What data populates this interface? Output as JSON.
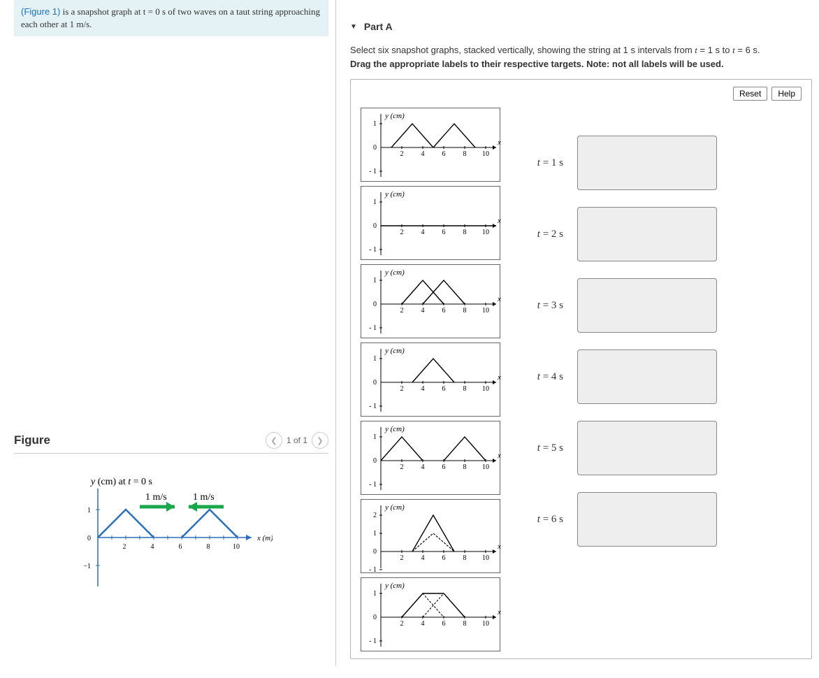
{
  "info": {
    "link": "(Figure 1)",
    "rest": " is a snapshot graph at t = 0 s of two waves on a taut string approaching each other at 1 m/s."
  },
  "figure": {
    "heading": "Figure",
    "counter": "1 of 1",
    "title": "y (cm) at t = 0 s",
    "ylabel": "y (cm)",
    "xlabel": "x (m)",
    "speed1": "1 m/s",
    "speed2": "1 m/s",
    "yticks": [
      "1",
      "0",
      "−1"
    ],
    "xticks": [
      "2",
      "4",
      "6",
      "8",
      "10"
    ]
  },
  "partA": {
    "title": "Part A",
    "instr": "Select six snapshot graphs, stacked vertically, showing the string at 1 s intervals from t = 1 s to t = 6 s.",
    "subinstr": "Drag the appropriate labels to their respective targets. Note: not all labels will be used.",
    "reset": "Reset",
    "help": "Help",
    "targets": [
      "t = 1 s",
      "t = 2 s",
      "t = 3 s",
      "t = 4 s",
      "t = 5 s",
      "t = 6 s"
    ],
    "label_ylabel": "y (cm)",
    "label_xlabel": "x (m)",
    "label_xticks": [
      "2",
      "4",
      "6",
      "8",
      "10"
    ]
  },
  "chart_data": {
    "figure1": {
      "type": "line",
      "title": "y (cm) at t = 0 s",
      "xlabel": "x (m)",
      "ylabel": "y (cm)",
      "xlim": [
        0,
        11
      ],
      "ylim": [
        -1.2,
        1.2
      ],
      "waves": [
        {
          "name": "left-pulse",
          "points": [
            [
              0,
              0
            ],
            [
              2,
              1
            ],
            [
              4,
              0
            ]
          ],
          "velocity_mps": 1
        },
        {
          "name": "right-pulse",
          "points": [
            [
              6,
              0
            ],
            [
              8,
              1
            ],
            [
              10,
              0
            ]
          ],
          "velocity_mps": -1
        }
      ]
    },
    "option_graphs": [
      {
        "id": "A",
        "ylim": [
          -1,
          1
        ],
        "segments": [
          [
            [
              1,
              0
            ],
            [
              3,
              1
            ],
            [
              5,
              0
            ]
          ],
          [
            [
              5,
              0
            ],
            [
              7,
              1
            ],
            [
              9,
              0
            ]
          ]
        ]
      },
      {
        "id": "B",
        "ylim": [
          -1,
          1
        ],
        "segments": [
          [
            [
              0,
              0
            ],
            [
              11,
              0
            ]
          ]
        ]
      },
      {
        "id": "C",
        "ylim": [
          -1,
          1
        ],
        "segments": [
          [
            [
              2,
              0
            ],
            [
              4,
              1
            ],
            [
              6,
              0
            ]
          ],
          [
            [
              4,
              0
            ],
            [
              6,
              1
            ],
            [
              8,
              0
            ]
          ]
        ],
        "dashed": [
          [
            [
              2,
              0
            ],
            [
              4,
              1
            ],
            [
              6,
              0
            ]
          ],
          [
            [
              4,
              0
            ],
            [
              6,
              1
            ],
            [
              8,
              0
            ]
          ]
        ]
      },
      {
        "id": "D",
        "ylim": [
          -1,
          1
        ],
        "segments": [
          [
            [
              3,
              0
            ],
            [
              5,
              1
            ],
            [
              7,
              0
            ]
          ]
        ]
      },
      {
        "id": "E",
        "ylim": [
          -1,
          1
        ],
        "segments": [
          [
            [
              0,
              0
            ],
            [
              2,
              1
            ],
            [
              4,
              0
            ]
          ],
          [
            [
              6,
              0
            ],
            [
              8,
              1
            ],
            [
              10,
              0
            ]
          ]
        ]
      },
      {
        "id": "F",
        "ylim": [
          -1,
          2
        ],
        "segments": [
          [
            [
              3,
              0
            ],
            [
              5,
              2
            ],
            [
              7,
              0
            ]
          ]
        ],
        "dashed": [
          [
            [
              3,
              0
            ],
            [
              5,
              1
            ],
            [
              7,
              0
            ]
          ],
          [
            [
              3,
              0
            ],
            [
              5,
              1
            ],
            [
              7,
              0
            ]
          ]
        ]
      },
      {
        "id": "G",
        "ylim": [
          -1,
          1
        ],
        "segments": [
          [
            [
              2,
              0
            ],
            [
              4,
              1
            ],
            [
              5,
              1
            ],
            [
              6,
              1
            ],
            [
              8,
              0
            ]
          ]
        ],
        "dashed": [
          [
            [
              2,
              0
            ],
            [
              4,
              1
            ],
            [
              6,
              0
            ]
          ],
          [
            [
              4,
              0
            ],
            [
              6,
              1
            ],
            [
              8,
              0
            ]
          ]
        ]
      }
    ]
  }
}
